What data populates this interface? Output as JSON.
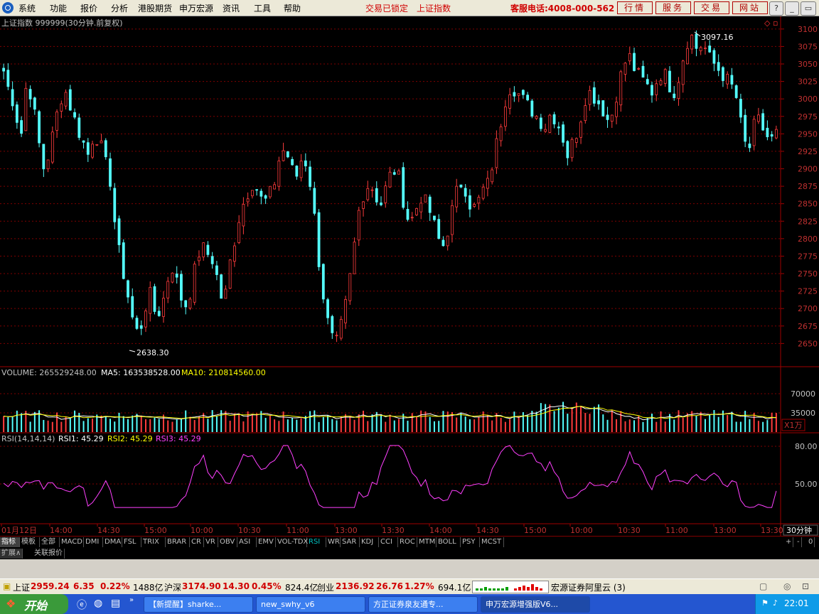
{
  "menu": [
    "系统",
    "功能",
    "报价",
    "分析",
    "港股期货",
    "申万宏源",
    "资讯",
    "工具",
    "帮助"
  ],
  "status_locked": "交易已锁定",
  "status_index": "上证指数",
  "hotline": "客服电话:4008-000-562",
  "top_buttons": [
    "行情",
    "服务",
    "交易",
    "网站"
  ],
  "window_buttons": [
    "?",
    "_",
    "▭",
    "×"
  ],
  "chart": {
    "title": "上证指数 999999(30分钟.前复权)",
    "high_label": "3097.16",
    "low_label": "2638.30",
    "y_ticks": [
      "3100",
      "3075",
      "3050",
      "3025",
      "3000",
      "2975",
      "2950",
      "2925",
      "2900",
      "2875",
      "2850",
      "2825",
      "2800",
      "2775",
      "2750",
      "2725",
      "2700",
      "2675",
      "2650"
    ],
    "volume_label": "VOLUME: 265529248.00",
    "ma5_label": "MA5: 163538528.00",
    "ma10_label": "MA10: 210814560.00",
    "vol_ticks": [
      "70000",
      "35000"
    ],
    "vol_unit": "X1万",
    "rsi_label": "RSI(14,14,14)",
    "rsi1_label": "RSI1: 45.29",
    "rsi2_label": "RSI2: 45.29",
    "rsi3_label": "RSI3: 45.29",
    "rsi_ticks": [
      "80.00",
      "50.00"
    ],
    "time_labels": [
      "01月12日",
      "14:00",
      "14:30",
      "15:00",
      "10:00",
      "10:30",
      "11:00",
      "13:00",
      "13:30",
      "14:00",
      "14:30",
      "15:00",
      "10:00",
      "10:30",
      "11:00",
      "13:00",
      "13:30"
    ],
    "period": "30分钟"
  },
  "chart_data": {
    "type": "candlestick",
    "title": "上证指数 999999(30分钟.前复权)",
    "ylim": [
      2630,
      3110
    ],
    "high": 3097.16,
    "low": 2638.3,
    "close_series": [
      3040,
      3010,
      2990,
      2940,
      3020,
      3005,
      2950,
      2900,
      2920,
      2960,
      3000,
      3010,
      2985,
      2960,
      2940,
      2920,
      2950,
      2940,
      2910,
      2880,
      2800,
      2760,
      2720,
      2680,
      2660,
      2700,
      2720,
      2690,
      2700,
      2740,
      2760,
      2730,
      2700,
      2720,
      2760,
      2790,
      2780,
      2770,
      2740,
      2700,
      2760,
      2800,
      2840,
      2860,
      2880,
      2870,
      2850,
      2860,
      2880,
      2920,
      2930,
      2900,
      2890,
      2920,
      2900,
      2840,
      2760,
      2700,
      2660,
      2650,
      2680,
      2720,
      2780,
      2840,
      2870,
      2880,
      2860,
      2850,
      2880,
      2900,
      2890,
      2850,
      2820,
      2840,
      2860,
      2850,
      2830,
      2800,
      2790,
      2820,
      2860,
      2880,
      2870,
      2840,
      2850,
      2870,
      2880,
      2920,
      2960,
      3000,
      3020,
      3010,
      3000,
      2990,
      2980,
      2970,
      2960,
      2980,
      2970,
      2950,
      2920,
      2940,
      2960,
      3000,
      3010,
      3000,
      2990,
      2970,
      2980,
      3020,
      3050,
      3060,
      3040,
      3030,
      3020,
      3010,
      3030,
      3040,
      3020,
      3010,
      3040,
      3080,
      3090,
      3070,
      3080,
      3060,
      3050,
      3040,
      3030,
      3020,
      3000,
      2950,
      2920,
      2960,
      2970,
      2950,
      2940,
      2950
    ],
    "volume_ylim": [
      0,
      90000
    ],
    "rsi": {
      "series": [
        {
          "name": "RSI1",
          "last": 45.29
        },
        {
          "name": "RSI2",
          "last": 45.29
        },
        {
          "name": "RSI3",
          "last": 45.29
        }
      ],
      "ylim": [
        20,
        90
      ]
    }
  },
  "indicator_tabs": [
    "指标",
    "模板",
    "全部",
    "MACD",
    "DMI",
    "DMA",
    "FSL",
    "TRIX",
    "BRAR",
    "CR",
    "VR",
    "OBV",
    "ASI",
    "EMV",
    "VOL-TDX",
    "RSI",
    "WR",
    "SAR",
    "KDJ",
    "CCI",
    "ROC",
    "MTM",
    "BOLL",
    "PSY",
    "MCST"
  ],
  "active_tab": "RSI",
  "tab_right": [
    "+",
    "-",
    "0"
  ],
  "sub_tabs": [
    "扩展∧",
    "关联报价"
  ],
  "status": {
    "sh_name": "上证",
    "sh_value": "2959.24",
    "sh_change": "6.35",
    "sh_pct": "0.22%",
    "sh_amount": "1488亿",
    "hs_name": "沪深",
    "hs_value": "3174.90",
    "hs_change": "14.30",
    "hs_pct": "0.45%",
    "hs_amount": "824.4亿",
    "cy_name": "创业",
    "cy_value": "2136.92",
    "cy_change": "26.76",
    "cy_pct": "1.27%",
    "cy_amount": "694.1亿",
    "server": "宏源证券阿里云 (3)"
  },
  "taskbar": {
    "start": "开始",
    "tasks": [
      "【新提醒】sharke...",
      "new_swhy_v6",
      "方正证券泉友通专...",
      "申万宏源增强版V6..."
    ],
    "clock": "22:01"
  },
  "colors": {
    "up": "#ff3c3c",
    "down": "#54ffff",
    "grid": "#800000",
    "ma5": "#ffffff",
    "ma10": "#ffff00",
    "rsi": "#ff40ff"
  }
}
